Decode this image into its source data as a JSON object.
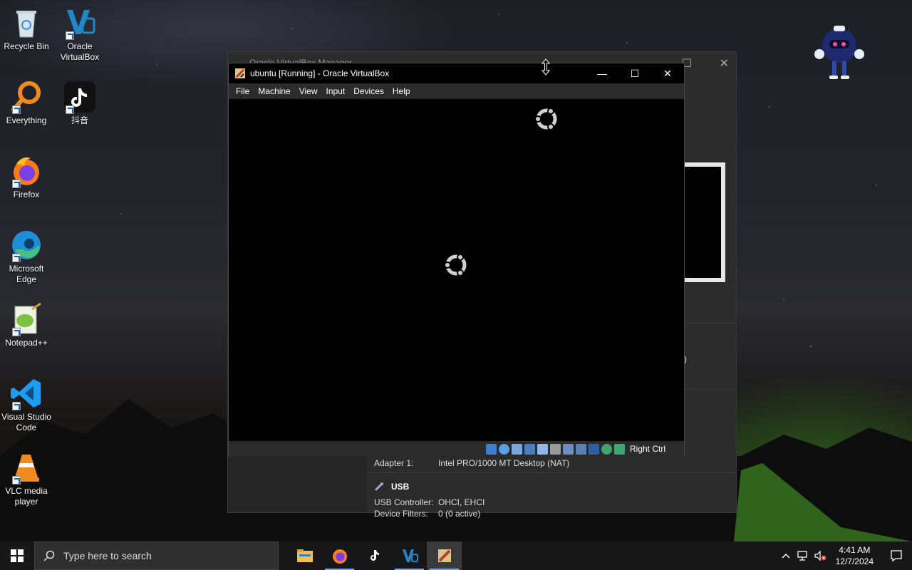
{
  "desktop": {
    "icons": [
      {
        "label": "Recycle Bin"
      },
      {
        "label": "Oracle VirtualBox"
      },
      {
        "label": "Everything"
      },
      {
        "label": "抖音"
      },
      {
        "label": "Firefox"
      },
      {
        "label": "Microsoft Edge"
      },
      {
        "label": "Notepad++"
      },
      {
        "label": "Visual Studio Code"
      },
      {
        "label": "VLC media player"
      }
    ]
  },
  "manager_window": {
    "title": "Oracle VirtualBox Manager",
    "partial_text": ")",
    "network": {
      "adapter_key": "Adapter 1:",
      "adapter_value": "Intel PRO/1000 MT Desktop (NAT)"
    },
    "usb": {
      "heading": "USB",
      "controller_key": "USB Controller:",
      "controller_value": "OHCI, EHCI",
      "filters_key": "Device Filters:",
      "filters_value": "0 (0 active)"
    }
  },
  "vm_window": {
    "title": "ubuntu [Running] - Oracle VirtualBox",
    "menu": [
      "File",
      "Machine",
      "View",
      "Input",
      "Devices",
      "Help"
    ],
    "host_key": "Right Ctrl",
    "status_icons": [
      "hard-disk-icon",
      "optical-drive-icon",
      "audio-icon",
      "network-icon",
      "usb-icon",
      "shared-folders-icon",
      "display-icon",
      "recording-icon",
      "vt-x-icon",
      "mouse-integration-icon",
      "keyboard-icon"
    ]
  },
  "taskbar": {
    "search_placeholder": "Type here to search",
    "apps": [
      "file-explorer-icon",
      "firefox-icon",
      "tiktok-icon",
      "virtualbox-icon",
      "virtualbox-vm-icon"
    ],
    "time": "4:41 AM",
    "date": "12/7/2024"
  },
  "colors": {
    "accent": "#6aa9ff",
    "window_bg": "#2b2b2b",
    "taskbar_bg": "#171717"
  }
}
